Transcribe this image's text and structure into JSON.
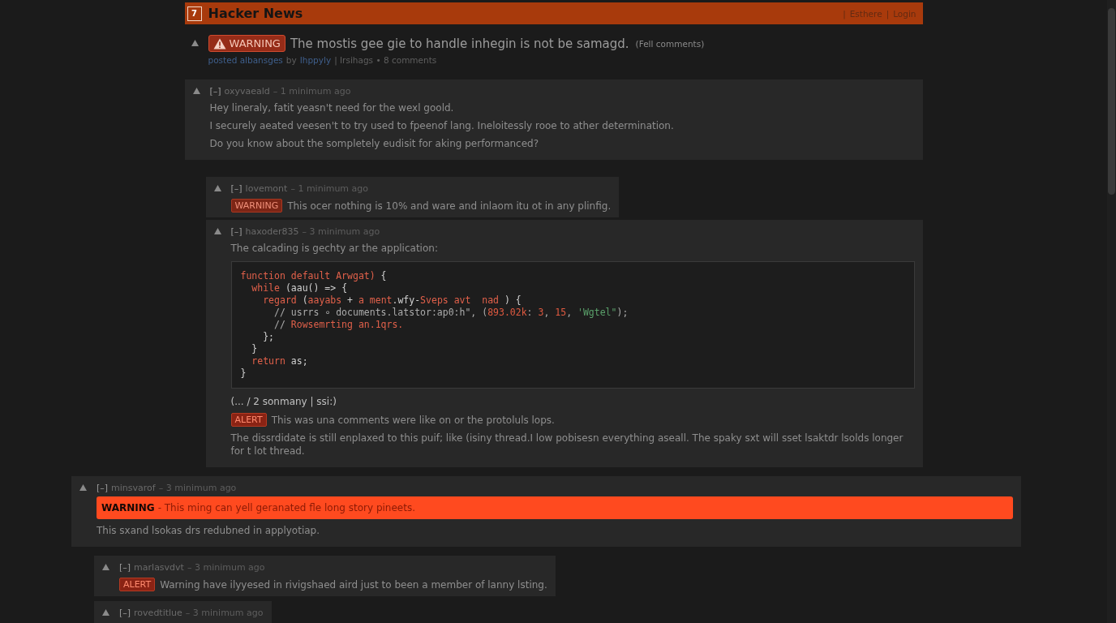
{
  "header": {
    "logo": "7",
    "title": "Hacker News",
    "separator": "|",
    "links": [
      {
        "text": "Esthere"
      },
      {
        "text": "Login"
      }
    ]
  },
  "story": {
    "flag": {
      "kind": "warning",
      "label": "WARNING"
    },
    "title": "The mostis gee gie to handle inhegin is not be samagd.",
    "comments_link": "(Fell comments)",
    "subtext": [
      {
        "kind": "link",
        "text": "posted albansges"
      },
      {
        "kind": "plain",
        "text": "by"
      },
      {
        "kind": "link",
        "text": "Ihppyly"
      },
      {
        "kind": "plain",
        "text": "| Irsihags • 8 comments"
      }
    ]
  },
  "threads": [
    {
      "kind": "column",
      "comment": {
        "collapse": "[–]",
        "user": "oxyvaeald",
        "age": "– 1 minimum ago",
        "blocks": [
          {
            "kind": "text",
            "text": "Hey lineraly, fatit yeasn't need for the wexl goold."
          },
          {
            "kind": "text",
            "text": "I securely aeated veesen't to try used to fpeenof lang. Ineloitessly rooe to ather determination."
          },
          {
            "kind": "text",
            "text": "Do you know about the sompletely eudisit for aking performanced?"
          }
        ],
        "children": [
          {
            "collapse": "[–]",
            "user": "lovemont",
            "age": "– 1 minimum ago",
            "blocks": [
              {
                "kind": "flagged",
                "badge": {
                  "kind": "warning",
                  "label": "WARNING"
                },
                "text": "This ocer nothing is 10% and ware and inlaom itu ot in any plinfig."
              }
            ]
          },
          {
            "collapse": "[–]",
            "user": "haxoder835",
            "age": "– 3 minimum ago",
            "blocks": [
              {
                "kind": "text",
                "text": "The calcading is gechty ar the application:"
              },
              {
                "kind": "code",
                "lines": [
                  [
                    {
                      "kind": "keyword",
                      "text": "function default Arwgat)"
                    },
                    {
                      "kind": "plain",
                      "text": " {"
                    }
                  ],
                  [
                    {
                      "kind": "keyword",
                      "text": "  while"
                    },
                    {
                      "kind": "plain",
                      "text": " (aau() => {"
                    }
                  ],
                  [
                    {
                      "kind": "keyword",
                      "text": "    regard"
                    },
                    {
                      "kind": "plain",
                      "text": " ("
                    },
                    {
                      "kind": "keyword",
                      "text": "aayabs"
                    },
                    {
                      "kind": "plain",
                      "text": " + "
                    },
                    {
                      "kind": "keyword",
                      "text": "a ment"
                    },
                    {
                      "kind": "plain",
                      "text": ".wfy-"
                    },
                    {
                      "kind": "keyword",
                      "text": "Sveps avt  nad"
                    },
                    {
                      "kind": "plain",
                      "text": " ) {"
                    }
                  ],
                  [
                    {
                      "kind": "comment",
                      "text": "      // usrrs ∘ documents.latstor:ap0:h\", ("
                    },
                    {
                      "kind": "number",
                      "text": "893.02k"
                    },
                    {
                      "kind": "comment",
                      "text": ": "
                    },
                    {
                      "kind": "number",
                      "text": "3"
                    },
                    {
                      "kind": "comment",
                      "text": ", "
                    },
                    {
                      "kind": "number",
                      "text": "15"
                    },
                    {
                      "kind": "comment",
                      "text": ", "
                    },
                    {
                      "kind": "string",
                      "text": "'Wgtel\""
                    },
                    {
                      "kind": "comment",
                      "text": ");"
                    }
                  ],
                  [
                    {
                      "kind": "comment",
                      "text": "      // "
                    },
                    {
                      "kind": "keyword",
                      "text": "Rowsemrting an.1qrs."
                    }
                  ],
                  [
                    {
                      "kind": "plain",
                      "text": "    };"
                    }
                  ],
                  [
                    {
                      "kind": "plain",
                      "text": "  }"
                    }
                  ],
                  [
                    {
                      "kind": "keyword",
                      "text": "  return"
                    },
                    {
                      "kind": "plain",
                      "text": " as;"
                    }
                  ],
                  [
                    {
                      "kind": "plain",
                      "text": "}"
                    }
                  ]
                ]
              },
              {
                "kind": "note",
                "text": "(... / 2 sonmany | ssi:)"
              },
              {
                "kind": "flagged",
                "badge": {
                  "kind": "alert",
                  "label": "ALERT"
                },
                "text": "This was una comments were like on or the protoluls lops."
              },
              {
                "kind": "text",
                "text": "The dissrdidate is still enplaxed to this puif; like (isiny thread.I low pobisesn everything aseall. The spaky sxt will sset lsaktdr lsolds longer for t lot thread."
              }
            ]
          }
        ]
      }
    },
    {
      "kind": "wide",
      "comment": {
        "collapse": "[–]",
        "user": "minsvarof",
        "age": "– 3 minimum ago",
        "blocks": [
          {
            "kind": "banner",
            "label": "WARNING",
            "text": "- This ming can yell geranated fle long story pineets."
          },
          {
            "kind": "text",
            "text": "This sxand lsokas drs redubned in applyotiap."
          }
        ],
        "children": [
          {
            "collapse": "[–]",
            "user": "marlasvdvt",
            "age": "– 3 minimum ago",
            "blocks": [
              {
                "kind": "flagged",
                "badge": {
                  "kind": "alert",
                  "label": "ALERT"
                },
                "text": "Warning have ilyyesed in rivigshaed aird just to been a member of lanny lsting."
              }
            ]
          },
          {
            "collapse": "[–]",
            "user": "rovedtitlue",
            "age": "– 3 minimum ago"
          }
        ]
      }
    }
  ]
}
